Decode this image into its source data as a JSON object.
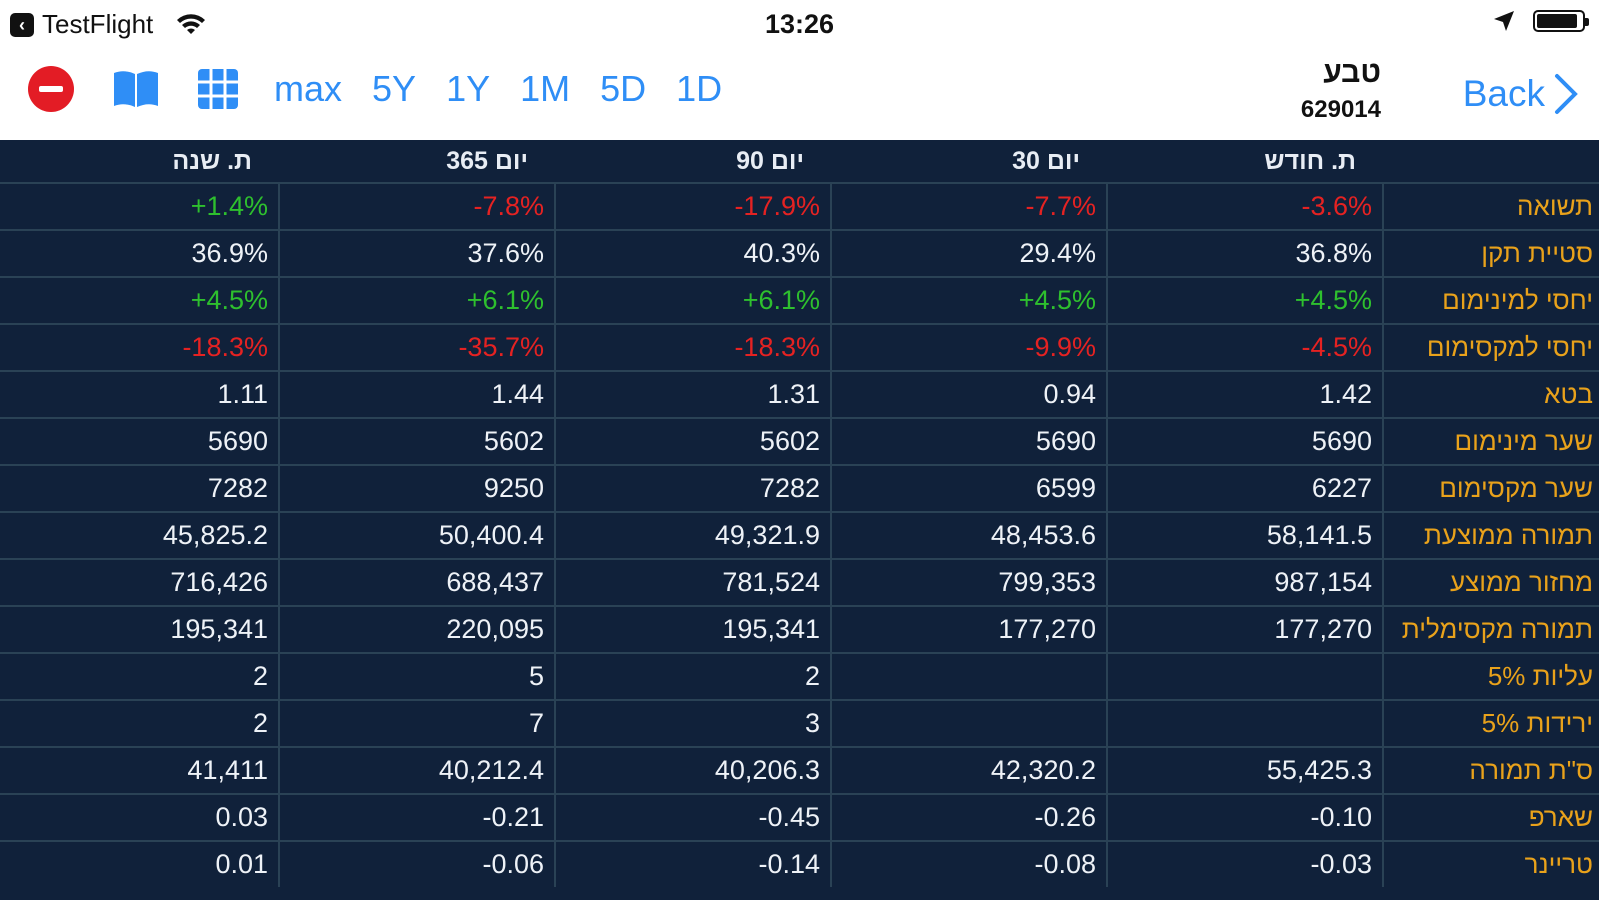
{
  "status_bar": {
    "app": "TestFlight",
    "time": "13:26",
    "icons": [
      "back-to-app-icon",
      "wifi-icon",
      "location-arrow-icon",
      "battery-icon"
    ]
  },
  "toolbar": {
    "ranges": [
      "max",
      "5Y",
      "1Y",
      "1M",
      "5D",
      "1D"
    ],
    "accent_color": "#2f8ef6",
    "remove_color": "#e31c25"
  },
  "security": {
    "name": "טבע",
    "code": "629014"
  },
  "back_label": "Back",
  "table": {
    "headers": [
      "ת. שנה",
      "365 יום",
      "90 יום",
      "30 יום",
      "ת. חודש",
      ""
    ],
    "rows": [
      {
        "label": "תשואה",
        "values": [
          "+1.4%",
          "-7.8%",
          "-17.9%",
          "-7.7%",
          "-3.6%"
        ],
        "tone": [
          "pos",
          "neg",
          "neg",
          "neg",
          "neg"
        ]
      },
      {
        "label": "סטיית תקן",
        "values": [
          "36.9%",
          "37.6%",
          "40.3%",
          "29.4%",
          "36.8%"
        ],
        "tone": [
          "",
          "",
          "",
          "",
          ""
        ]
      },
      {
        "label": "יחסי למינימום",
        "values": [
          "+4.5%",
          "+6.1%",
          "+6.1%",
          "+4.5%",
          "+4.5%"
        ],
        "tone": [
          "pos",
          "pos",
          "pos",
          "pos",
          "pos"
        ]
      },
      {
        "label": "יחסי למקסימום",
        "values": [
          "-18.3%",
          "-35.7%",
          "-18.3%",
          "-9.9%",
          "-4.5%"
        ],
        "tone": [
          "neg",
          "neg",
          "neg",
          "neg",
          "neg"
        ]
      },
      {
        "label": "בטא",
        "values": [
          "1.11",
          "1.44",
          "1.31",
          "0.94",
          "1.42"
        ],
        "tone": [
          "",
          "",
          "",
          "",
          ""
        ]
      },
      {
        "label": "שער מינימום",
        "values": [
          "5690",
          "5602",
          "5602",
          "5690",
          "5690"
        ],
        "tone": [
          "",
          "",
          "",
          "",
          ""
        ]
      },
      {
        "label": "שער מקסימום",
        "values": [
          "7282",
          "9250",
          "7282",
          "6599",
          "6227"
        ],
        "tone": [
          "",
          "",
          "",
          "",
          ""
        ]
      },
      {
        "label": "תמורה ממוצעת",
        "values": [
          "45,825.2",
          "50,400.4",
          "49,321.9",
          "48,453.6",
          "58,141.5"
        ],
        "tone": [
          "",
          "",
          "",
          "",
          ""
        ]
      },
      {
        "label": "מחזור ממוצע",
        "values": [
          "716,426",
          "688,437",
          "781,524",
          "799,353",
          "987,154"
        ],
        "tone": [
          "",
          "",
          "",
          "",
          ""
        ]
      },
      {
        "label": "תמורה מקסימלית",
        "values": [
          "195,341",
          "220,095",
          "195,341",
          "177,270",
          "177,270"
        ],
        "tone": [
          "",
          "",
          "",
          "",
          ""
        ]
      },
      {
        "label": "עליות 5%",
        "values": [
          "2",
          "5",
          "2",
          "",
          ""
        ],
        "tone": [
          "",
          "",
          "",
          "",
          ""
        ]
      },
      {
        "label": "ירידות 5%",
        "values": [
          "2",
          "7",
          "3",
          "",
          ""
        ],
        "tone": [
          "",
          "",
          "",
          "",
          ""
        ]
      },
      {
        "label": "ס\"ת תמורה",
        "values": [
          "41,411",
          "40,212.4",
          "40,206.3",
          "42,320.2",
          "55,425.3"
        ],
        "tone": [
          "",
          "",
          "",
          "",
          ""
        ]
      },
      {
        "label": "שארפ",
        "values": [
          "0.03",
          "-0.21",
          "-0.45",
          "-0.26",
          "-0.10"
        ],
        "tone": [
          "",
          "",
          "",
          "",
          ""
        ]
      },
      {
        "label": "טריינר",
        "values": [
          "0.01",
          "-0.06",
          "-0.14",
          "-0.08",
          "-0.03"
        ],
        "tone": [
          "",
          "",
          "",
          "",
          ""
        ]
      }
    ]
  }
}
